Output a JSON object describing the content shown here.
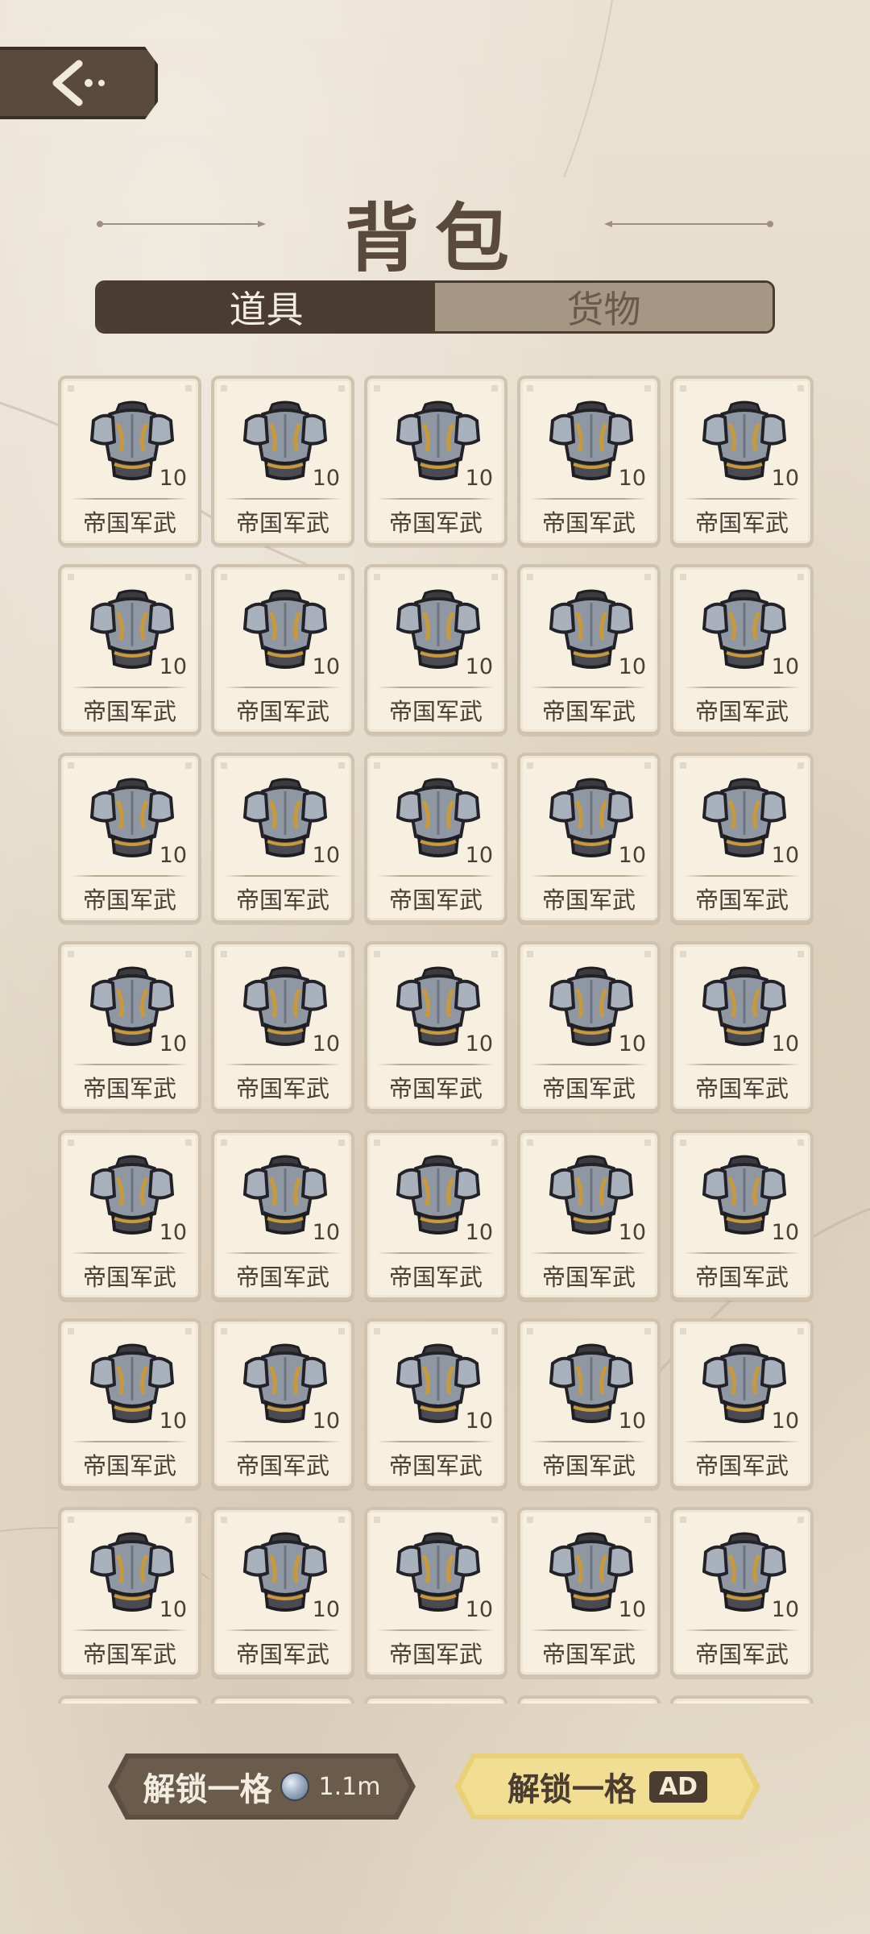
{
  "header": {
    "back_icon": "back-arrow-icon",
    "title": "背包"
  },
  "tabs": [
    {
      "label": "道具",
      "active": true
    },
    {
      "label": "货物",
      "active": false
    }
  ],
  "inventory": {
    "items": [
      {
        "name": "帝国军武",
        "count": "10",
        "icon": "armor-icon"
      },
      {
        "name": "帝国军武",
        "count": "10",
        "icon": "armor-icon"
      },
      {
        "name": "帝国军武",
        "count": "10",
        "icon": "armor-icon"
      },
      {
        "name": "帝国军武",
        "count": "10",
        "icon": "armor-icon"
      },
      {
        "name": "帝国军武",
        "count": "10",
        "icon": "armor-icon"
      },
      {
        "name": "帝国军武",
        "count": "10",
        "icon": "armor-icon"
      },
      {
        "name": "帝国军武",
        "count": "10",
        "icon": "armor-icon"
      },
      {
        "name": "帝国军武",
        "count": "10",
        "icon": "armor-icon"
      },
      {
        "name": "帝国军武",
        "count": "10",
        "icon": "armor-icon"
      },
      {
        "name": "帝国军武",
        "count": "10",
        "icon": "armor-icon"
      },
      {
        "name": "帝国军武",
        "count": "10",
        "icon": "armor-icon"
      },
      {
        "name": "帝国军武",
        "count": "10",
        "icon": "armor-icon"
      },
      {
        "name": "帝国军武",
        "count": "10",
        "icon": "armor-icon"
      },
      {
        "name": "帝国军武",
        "count": "10",
        "icon": "armor-icon"
      },
      {
        "name": "帝国军武",
        "count": "10",
        "icon": "armor-icon"
      },
      {
        "name": "帝国军武",
        "count": "10",
        "icon": "armor-icon"
      },
      {
        "name": "帝国军武",
        "count": "10",
        "icon": "armor-icon"
      },
      {
        "name": "帝国军武",
        "count": "10",
        "icon": "armor-icon"
      },
      {
        "name": "帝国军武",
        "count": "10",
        "icon": "armor-icon"
      },
      {
        "name": "帝国军武",
        "count": "10",
        "icon": "armor-icon"
      },
      {
        "name": "帝国军武",
        "count": "10",
        "icon": "armor-icon"
      },
      {
        "name": "帝国军武",
        "count": "10",
        "icon": "armor-icon"
      },
      {
        "name": "帝国军武",
        "count": "10",
        "icon": "armor-icon"
      },
      {
        "name": "帝国军武",
        "count": "10",
        "icon": "armor-icon"
      },
      {
        "name": "帝国军武",
        "count": "10",
        "icon": "armor-icon"
      },
      {
        "name": "帝国军武",
        "count": "10",
        "icon": "armor-icon"
      },
      {
        "name": "帝国军武",
        "count": "10",
        "icon": "armor-icon"
      },
      {
        "name": "帝国军武",
        "count": "10",
        "icon": "armor-icon"
      },
      {
        "name": "帝国军武",
        "count": "10",
        "icon": "armor-icon"
      },
      {
        "name": "帝国军武",
        "count": "10",
        "icon": "armor-icon"
      },
      {
        "name": "帝国军武",
        "count": "10",
        "icon": "armor-icon"
      },
      {
        "name": "帝国军武",
        "count": "10",
        "icon": "armor-icon"
      },
      {
        "name": "帝国军武",
        "count": "10",
        "icon": "armor-icon"
      },
      {
        "name": "帝国军武",
        "count": "10",
        "icon": "armor-icon"
      },
      {
        "name": "帝国军武",
        "count": "10",
        "icon": "armor-icon"
      }
    ]
  },
  "actions": {
    "unlock_coin_label": "解锁一格",
    "unlock_coin_icon": "silver-coin-icon",
    "unlock_coin_cost": "1.1m",
    "unlock_ad_label": "解锁一格",
    "unlock_ad_badge": "AD"
  }
}
